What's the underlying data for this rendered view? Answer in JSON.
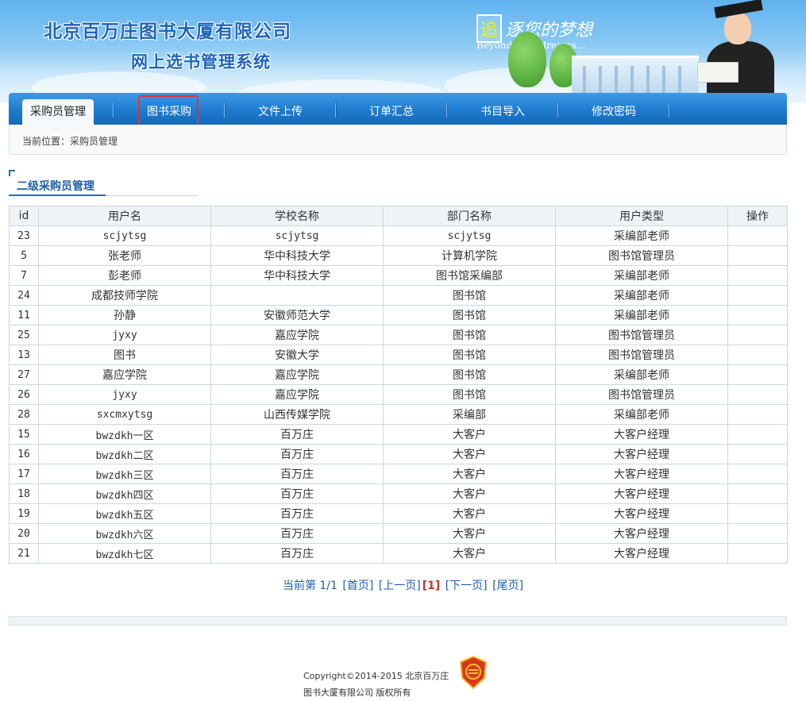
{
  "header": {
    "company": "北京百万庄图书大厦有限公司",
    "system": "网上选书管理系统",
    "slogan_box": "追",
    "slogan": "逐您的梦想",
    "slogan_en": "Beyond your dreams..."
  },
  "nav": {
    "tabs": [
      {
        "label": "采购员管理",
        "active": true
      },
      {
        "label": "图书采购"
      },
      {
        "label": "文件上传"
      },
      {
        "label": "订单汇总"
      },
      {
        "label": "书目导入"
      },
      {
        "label": "修改密码"
      }
    ]
  },
  "breadcrumb": "当前位置：采购员管理",
  "section_title": "二级采购员管理",
  "table": {
    "headers": [
      "id",
      "用户名",
      "学校名称",
      "部门名称",
      "用户类型",
      "操作"
    ],
    "rows": [
      [
        "23",
        "scjytsg",
        "scjytsg",
        "scjytsg",
        "采编部老师",
        ""
      ],
      [
        "5",
        "张老师",
        "华中科技大学",
        "计算机学院",
        "图书馆管理员",
        ""
      ],
      [
        "7",
        "彭老师",
        "华中科技大学",
        "图书馆采编部",
        "采编部老师",
        ""
      ],
      [
        "24",
        "成都技师学院",
        "",
        "图书馆",
        "采编部老师",
        ""
      ],
      [
        "11",
        "孙静",
        "安徽师范大学",
        "图书馆",
        "采编部老师",
        ""
      ],
      [
        "25",
        "jyxy",
        "嘉应学院",
        "图书馆",
        "图书馆管理员",
        ""
      ],
      [
        "13",
        "图书",
        "安徽大学",
        "图书馆",
        "图书馆管理员",
        ""
      ],
      [
        "27",
        "嘉应学院",
        "嘉应学院",
        "图书馆",
        "采编部老师",
        ""
      ],
      [
        "26",
        "jyxy",
        "嘉应学院",
        "图书馆",
        "图书馆管理员",
        ""
      ],
      [
        "28",
        "sxcmxytsg",
        "山西传媒学院",
        "采编部",
        "采编部老师",
        ""
      ],
      [
        "15",
        "bwzdkh一区",
        "百万庄",
        "大客户",
        "大客户经理",
        ""
      ],
      [
        "16",
        "bwzdkh二区",
        "百万庄",
        "大客户",
        "大客户经理",
        ""
      ],
      [
        "17",
        "bwzdkh三区",
        "百万庄",
        "大客户",
        "大客户经理",
        ""
      ],
      [
        "18",
        "bwzdkh四区",
        "百万庄",
        "大客户",
        "大客户经理",
        ""
      ],
      [
        "19",
        "bwzdkh五区",
        "百万庄",
        "大客户",
        "大客户经理",
        ""
      ],
      [
        "20",
        "bwzdkh六区",
        "百万庄",
        "大客户",
        "大客户经理",
        ""
      ],
      [
        "21",
        "bwzdkh七区",
        "百万庄",
        "大客户",
        "大客户经理",
        ""
      ]
    ]
  },
  "pager": {
    "current_label": "当前第 1/1",
    "first": "[首页]",
    "prev": "[上一页]",
    "page": "[1]",
    "next": "[下一页]",
    "last": "[尾页]"
  },
  "footer": {
    "line1": "Copyright©2014-2015 北京百万庄",
    "line2": "图书大厦有限公司 版权所有"
  },
  "colors": {
    "nav_blue": "#1f7bcf",
    "highlight_red": "#e63131",
    "title_blue": "#1f5fa8"
  }
}
